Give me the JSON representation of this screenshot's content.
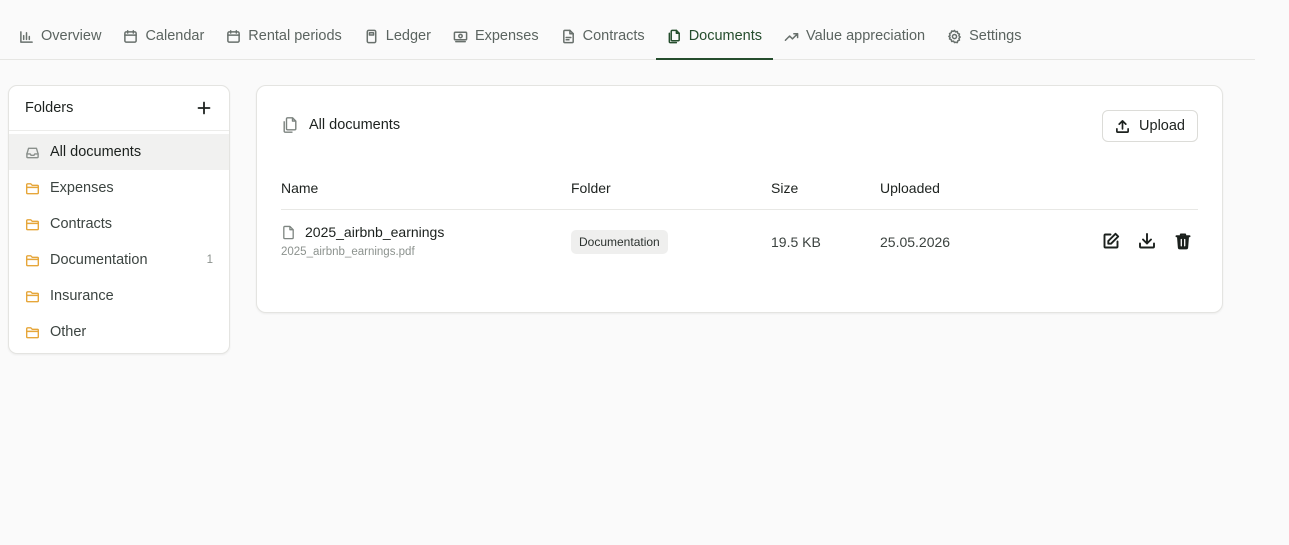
{
  "nav": {
    "tabs": [
      {
        "label": "Overview",
        "icon": "bar-chart-icon"
      },
      {
        "label": "Calendar",
        "icon": "calendar-icon"
      },
      {
        "label": "Rental periods",
        "icon": "calendar-range-icon"
      },
      {
        "label": "Ledger",
        "icon": "calculator-icon"
      },
      {
        "label": "Expenses",
        "icon": "banknote-icon"
      },
      {
        "label": "Contracts",
        "icon": "file-text-icon"
      },
      {
        "label": "Documents",
        "icon": "files-icon",
        "active": true
      },
      {
        "label": "Value appreciation",
        "icon": "trending-up-icon"
      },
      {
        "label": "Settings",
        "icon": "gear-icon"
      }
    ]
  },
  "folders": {
    "title": "Folders",
    "items": [
      {
        "label": "All documents",
        "icon": "inbox-icon",
        "active": true,
        "count": ""
      },
      {
        "label": "Expenses",
        "icon": "folder-icon",
        "count": ""
      },
      {
        "label": "Contracts",
        "icon": "folder-icon",
        "count": ""
      },
      {
        "label": "Documentation",
        "icon": "folder-icon",
        "count": "1"
      },
      {
        "label": "Insurance",
        "icon": "folder-icon",
        "count": ""
      },
      {
        "label": "Other",
        "icon": "folder-icon",
        "count": ""
      }
    ]
  },
  "documents": {
    "title": "All documents",
    "upload_label": "Upload",
    "columns": {
      "name": "Name",
      "folder": "Folder",
      "size": "Size",
      "uploaded": "Uploaded"
    },
    "rows": [
      {
        "name": "2025_airbnb_earnings",
        "filename": "2025_airbnb_earnings.pdf",
        "folder": "Documentation",
        "size": "19.5 KB",
        "uploaded": "25.05.2026"
      }
    ]
  },
  "colors": {
    "accent": "#254d2d",
    "folder_icon": "#e6a63a",
    "background": "#fafafa"
  }
}
